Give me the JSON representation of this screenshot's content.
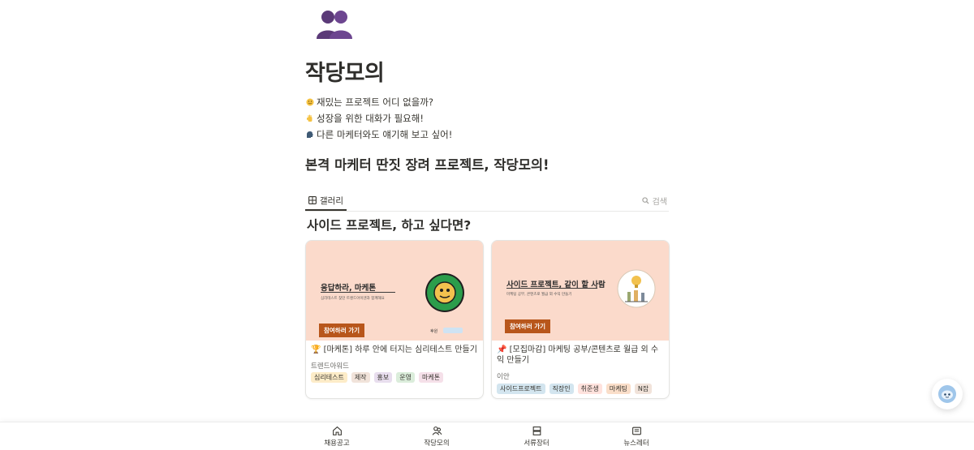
{
  "page": {
    "icon": "two-people-icon",
    "title": "작당모의",
    "lines": [
      {
        "emoji": "face-icon",
        "text": "재밌는 프로젝트 어디 없을까?"
      },
      {
        "emoji": "hand-icon",
        "text": "성장을 위한 대화가 필요해!"
      },
      {
        "emoji": "speaking-head-icon",
        "text": "다른 마케터와도 얘기해 보고 싶어!"
      }
    ],
    "heading": "본격 마케터 딴짓 장려 프로젝트, 작당모의!"
  },
  "view": {
    "tab_label": "갤러리",
    "search_label": "검색"
  },
  "section_heading": "사이드 프로젝트, 하고 싶다면?",
  "cards": [
    {
      "cover": {
        "title": "응답하라, 마케톤",
        "subtitle": "심리테스트 찾던 트렌드아이덴과 함께해요",
        "button": "참여하러 가기",
        "badge_text": "후원"
      },
      "title": "🏆 [마케톤] 하루 안에 터지는 심리테스트 만들기",
      "subtitle": "트렌드아워드",
      "tags": [
        "심리테스트",
        "제작",
        "홍보",
        "운영",
        "마케톤"
      ]
    },
    {
      "cover": {
        "title": "사이드 프로젝트, 같이 할 사람",
        "subtitle": "마케팅 공부, 콘텐츠로 월급 외 수익 만들기",
        "button": "참여하러 가기"
      },
      "title": "📌 [모집마감] 마케팅 공부/콘텐츠로 월급 외 수익 만들기",
      "subtitle": "이안",
      "tags": [
        "사이드프로젝트",
        "직장인",
        "취준생",
        "마케팅",
        "N잡"
      ]
    }
  ],
  "tag_colors": {
    "tag1": "#fdecc8",
    "tag2": "#f1e3da",
    "tag3": "#e8deee",
    "tag4": "#dbeddb",
    "tag5": "#f5e0e9",
    "tag6": "#d3e5ef",
    "tag7": "#d3e5ef",
    "tag8": "#ffe2dd",
    "tag9": "#fadec9",
    "tag10": "#f1e3da"
  },
  "bottom_nav": [
    {
      "icon": "home-icon",
      "label": "채용공고"
    },
    {
      "icon": "people-icon",
      "label": "작당모의"
    },
    {
      "icon": "documents-icon",
      "label": "서류장터"
    },
    {
      "icon": "newsletter-icon",
      "label": "뉴스레터"
    }
  ],
  "colors": {
    "accent_button": "#b8561b",
    "cover_bg": "#fbdacb",
    "text": "#37352f"
  }
}
